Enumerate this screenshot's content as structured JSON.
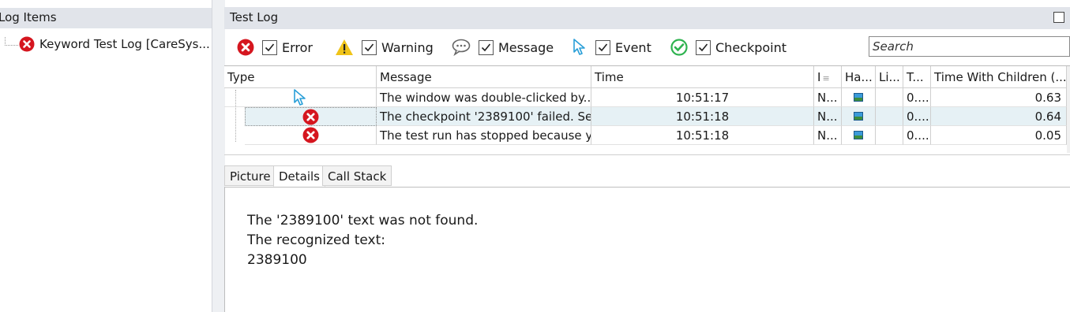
{
  "left_panel": {
    "title": "Log Items",
    "tree_item": {
      "label": "Keyword Test Log [CareSys...",
      "icon": "error-icon"
    }
  },
  "test_log": {
    "title": "Test Log",
    "search_placeholder": "Search",
    "filters": [
      {
        "label": "Error",
        "icon": "error-icon",
        "checked": true
      },
      {
        "label": "Warning",
        "icon": "warning-icon",
        "checked": true
      },
      {
        "label": "Message",
        "icon": "message-icon",
        "checked": true
      },
      {
        "label": "Event",
        "icon": "event-cursor-icon",
        "checked": true
      },
      {
        "label": "Checkpoint",
        "icon": "checkpoint-icon",
        "checked": true
      }
    ],
    "columns": [
      "Type",
      "Message",
      "Time",
      "I",
      "Ha...",
      "Li...",
      "T...",
      "Time With Children (..."
    ],
    "rows": [
      {
        "type_icon": "event-cursor-icon",
        "message": "The window was double-clicked by...",
        "time": "10:51:17",
        "priority": "N...",
        "has_picture": "picture-icon",
        "link": "",
        "t": "0....",
        "time_with_children": "0.63",
        "selected": false
      },
      {
        "type_icon": "error-icon",
        "message": "The checkpoint '2389100' failed. Se...",
        "time": "10:51:18",
        "priority": "N...",
        "has_picture": "picture-icon",
        "link": "",
        "t": "0....",
        "time_with_children": "0.64",
        "selected": true
      },
      {
        "type_icon": "error-icon",
        "message": "The test run has stopped because y...",
        "time": "10:51:18",
        "priority": "N...",
        "has_picture": "picture-icon",
        "link": "",
        "t": "0....",
        "time_with_children": "0.05",
        "selected": false
      }
    ],
    "tabs": [
      "Picture",
      "Details",
      "Call Stack"
    ],
    "active_tab": "Details",
    "details": {
      "line1": "The '2389100' text was not found.",
      "line2": "The recognized text:",
      "line3": "2389100"
    }
  },
  "colors": {
    "error": "#d5161f",
    "warning": "#f0c419",
    "checkpoint": "#2fb350",
    "event": "#2a9fd8",
    "header_bg": "#e1e4ea",
    "selected_row": "#e6f1f5"
  }
}
